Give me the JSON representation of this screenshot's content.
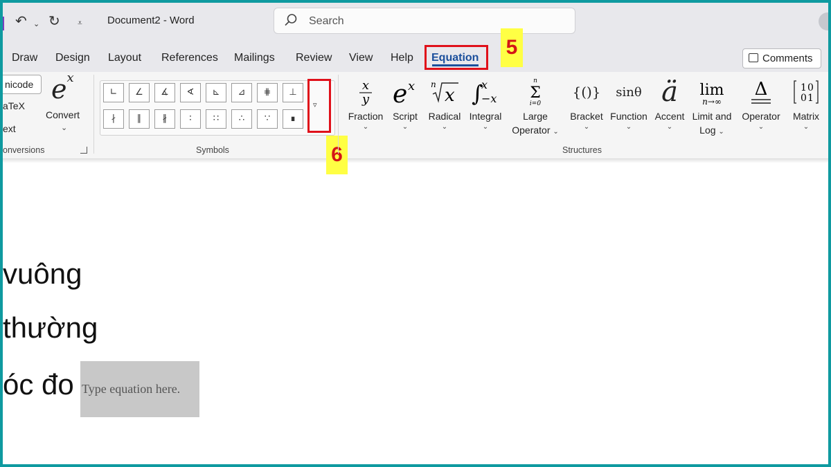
{
  "titlebar": {
    "doc_title": "Document2  -  Word",
    "search_placeholder": "Search"
  },
  "tabs": [
    {
      "label": "Draw"
    },
    {
      "label": "Design"
    },
    {
      "label": "Layout"
    },
    {
      "label": "References"
    },
    {
      "label": "Mailings"
    },
    {
      "label": "Review"
    },
    {
      "label": "View"
    },
    {
      "label": "Help"
    },
    {
      "label": "Equation",
      "active": true
    }
  ],
  "comments_label": "Comments",
  "conversions": {
    "unicode_label": "nicode",
    "latex_label": "aTeX",
    "text_label": "ext",
    "convert_label": "Convert",
    "convert_icon_base": "e",
    "convert_icon_exp": "x",
    "group_label": "onversions"
  },
  "symbols": {
    "row1": [
      "∟",
      "∠",
      "∡",
      "∢",
      "⊾",
      "⊿",
      "⋕",
      "⊥"
    ],
    "row2": [
      "∤",
      "∥",
      "∦",
      "∶",
      "∷",
      "∴",
      "∵",
      "∎"
    ],
    "more_icon": "dropdown-more-icon",
    "group_label": "Symbols"
  },
  "annotations": {
    "step5": "5",
    "step6": "6",
    "highlight_color": "#e0101a",
    "tag_color": "#ffff44"
  },
  "structures": {
    "group_label": "Structures",
    "items": [
      {
        "label": "Fraction",
        "icon": "x/y"
      },
      {
        "label": "Script",
        "icon": "e^x"
      },
      {
        "label": "Radical",
        "icon": "ⁿ√x"
      },
      {
        "label": "Integral",
        "icon": "∫x −x"
      },
      {
        "label": "Large",
        "label2": "Operator",
        "icon": "Σ"
      },
      {
        "label": "Bracket",
        "icon": "{()}"
      },
      {
        "label": "Function",
        "icon": "sinθ"
      },
      {
        "label": "Accent",
        "icon": "ä"
      },
      {
        "label": "Limit and",
        "label2": "Log",
        "icon": "lim"
      },
      {
        "label": "Operator",
        "icon": "Δ"
      },
      {
        "label": "Matrix",
        "icon": "[10;01]"
      }
    ]
  },
  "document": {
    "lines": [
      "vuông",
      "thường",
      "óc đo"
    ],
    "equation_placeholder": "Type equation here."
  }
}
